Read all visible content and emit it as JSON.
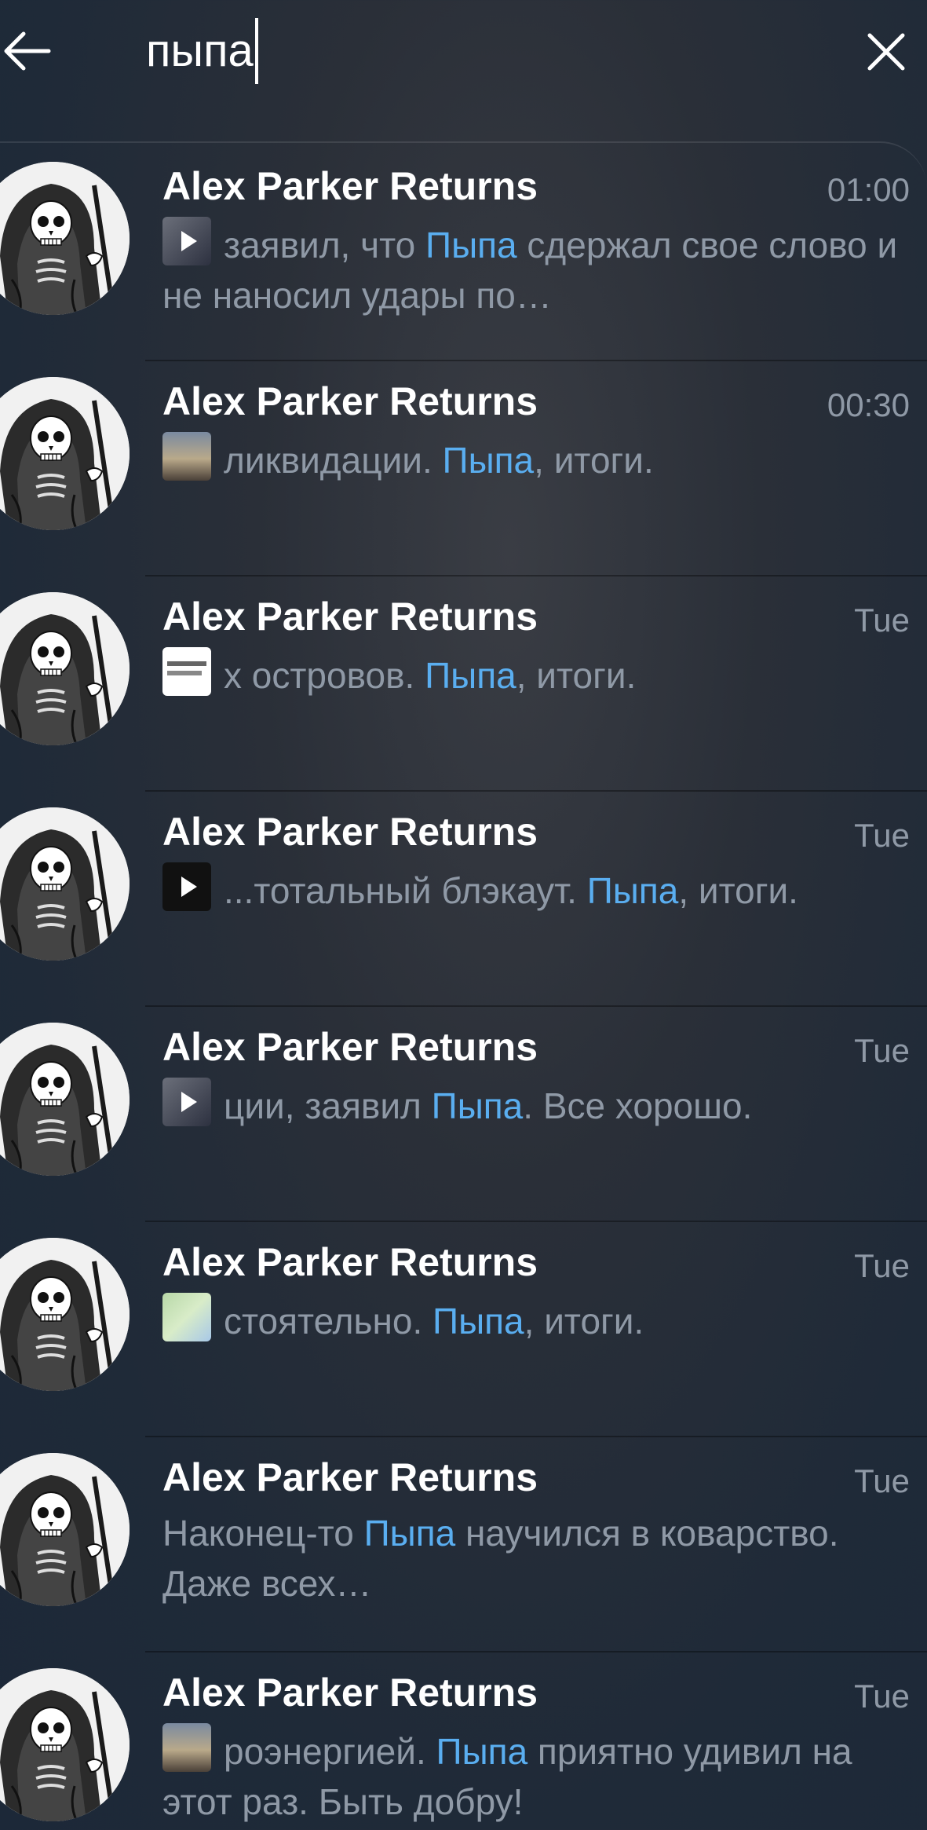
{
  "search": {
    "query": "пыпа"
  },
  "results": [
    {
      "title": "Alex Parker Returns",
      "time": "01:00",
      "thumb": "video",
      "before": "заявил, что ",
      "match": "Пыпа",
      "after": " сдержал свое слово и не наносил удары по…"
    },
    {
      "title": "Alex Parker Returns",
      "time": "00:30",
      "thumb": "photo",
      "before": "ликвидации. ",
      "match": "Пыпа",
      "after": ", итоги."
    },
    {
      "title": "Alex Parker Returns",
      "time": "Tue",
      "thumb": "document",
      "before": "х островов. ",
      "match": "Пыпа",
      "after": ", итоги."
    },
    {
      "title": "Alex Parker Returns",
      "time": "Tue",
      "thumb": "video-dark",
      "before": "...тотальный блэкаут. ",
      "match": "Пыпа",
      "after": ", итоги."
    },
    {
      "title": "Alex Parker Returns",
      "time": "Tue",
      "thumb": "video",
      "before": "ции, заявил ",
      "match": "Пыпа",
      "after": ". Все хорошо."
    },
    {
      "title": "Alex Parker Returns",
      "time": "Tue",
      "thumb": "map",
      "before": "стоятельно. ",
      "match": "Пыпа",
      "after": ", итоги."
    },
    {
      "title": "Alex Parker Returns",
      "time": "Tue",
      "thumb": "none",
      "before": " Наконец-то ",
      "match": "Пыпа",
      "after": " научился в коварство. Даже всех…"
    },
    {
      "title": "Alex Parker Returns",
      "time": "Tue",
      "thumb": "photo",
      "before": "роэнергией. ",
      "match": "Пыпа",
      "after": " приятно удивил на этот раз. Быть добру!"
    }
  ],
  "icons": {
    "back": "arrow-left-icon",
    "close": "close-icon",
    "avatar": "grim-reaper-avatar"
  },
  "colors": {
    "highlight": "#5aaef0",
    "secondary_text": "#8f99a6",
    "primary_text": "#ffffff"
  }
}
